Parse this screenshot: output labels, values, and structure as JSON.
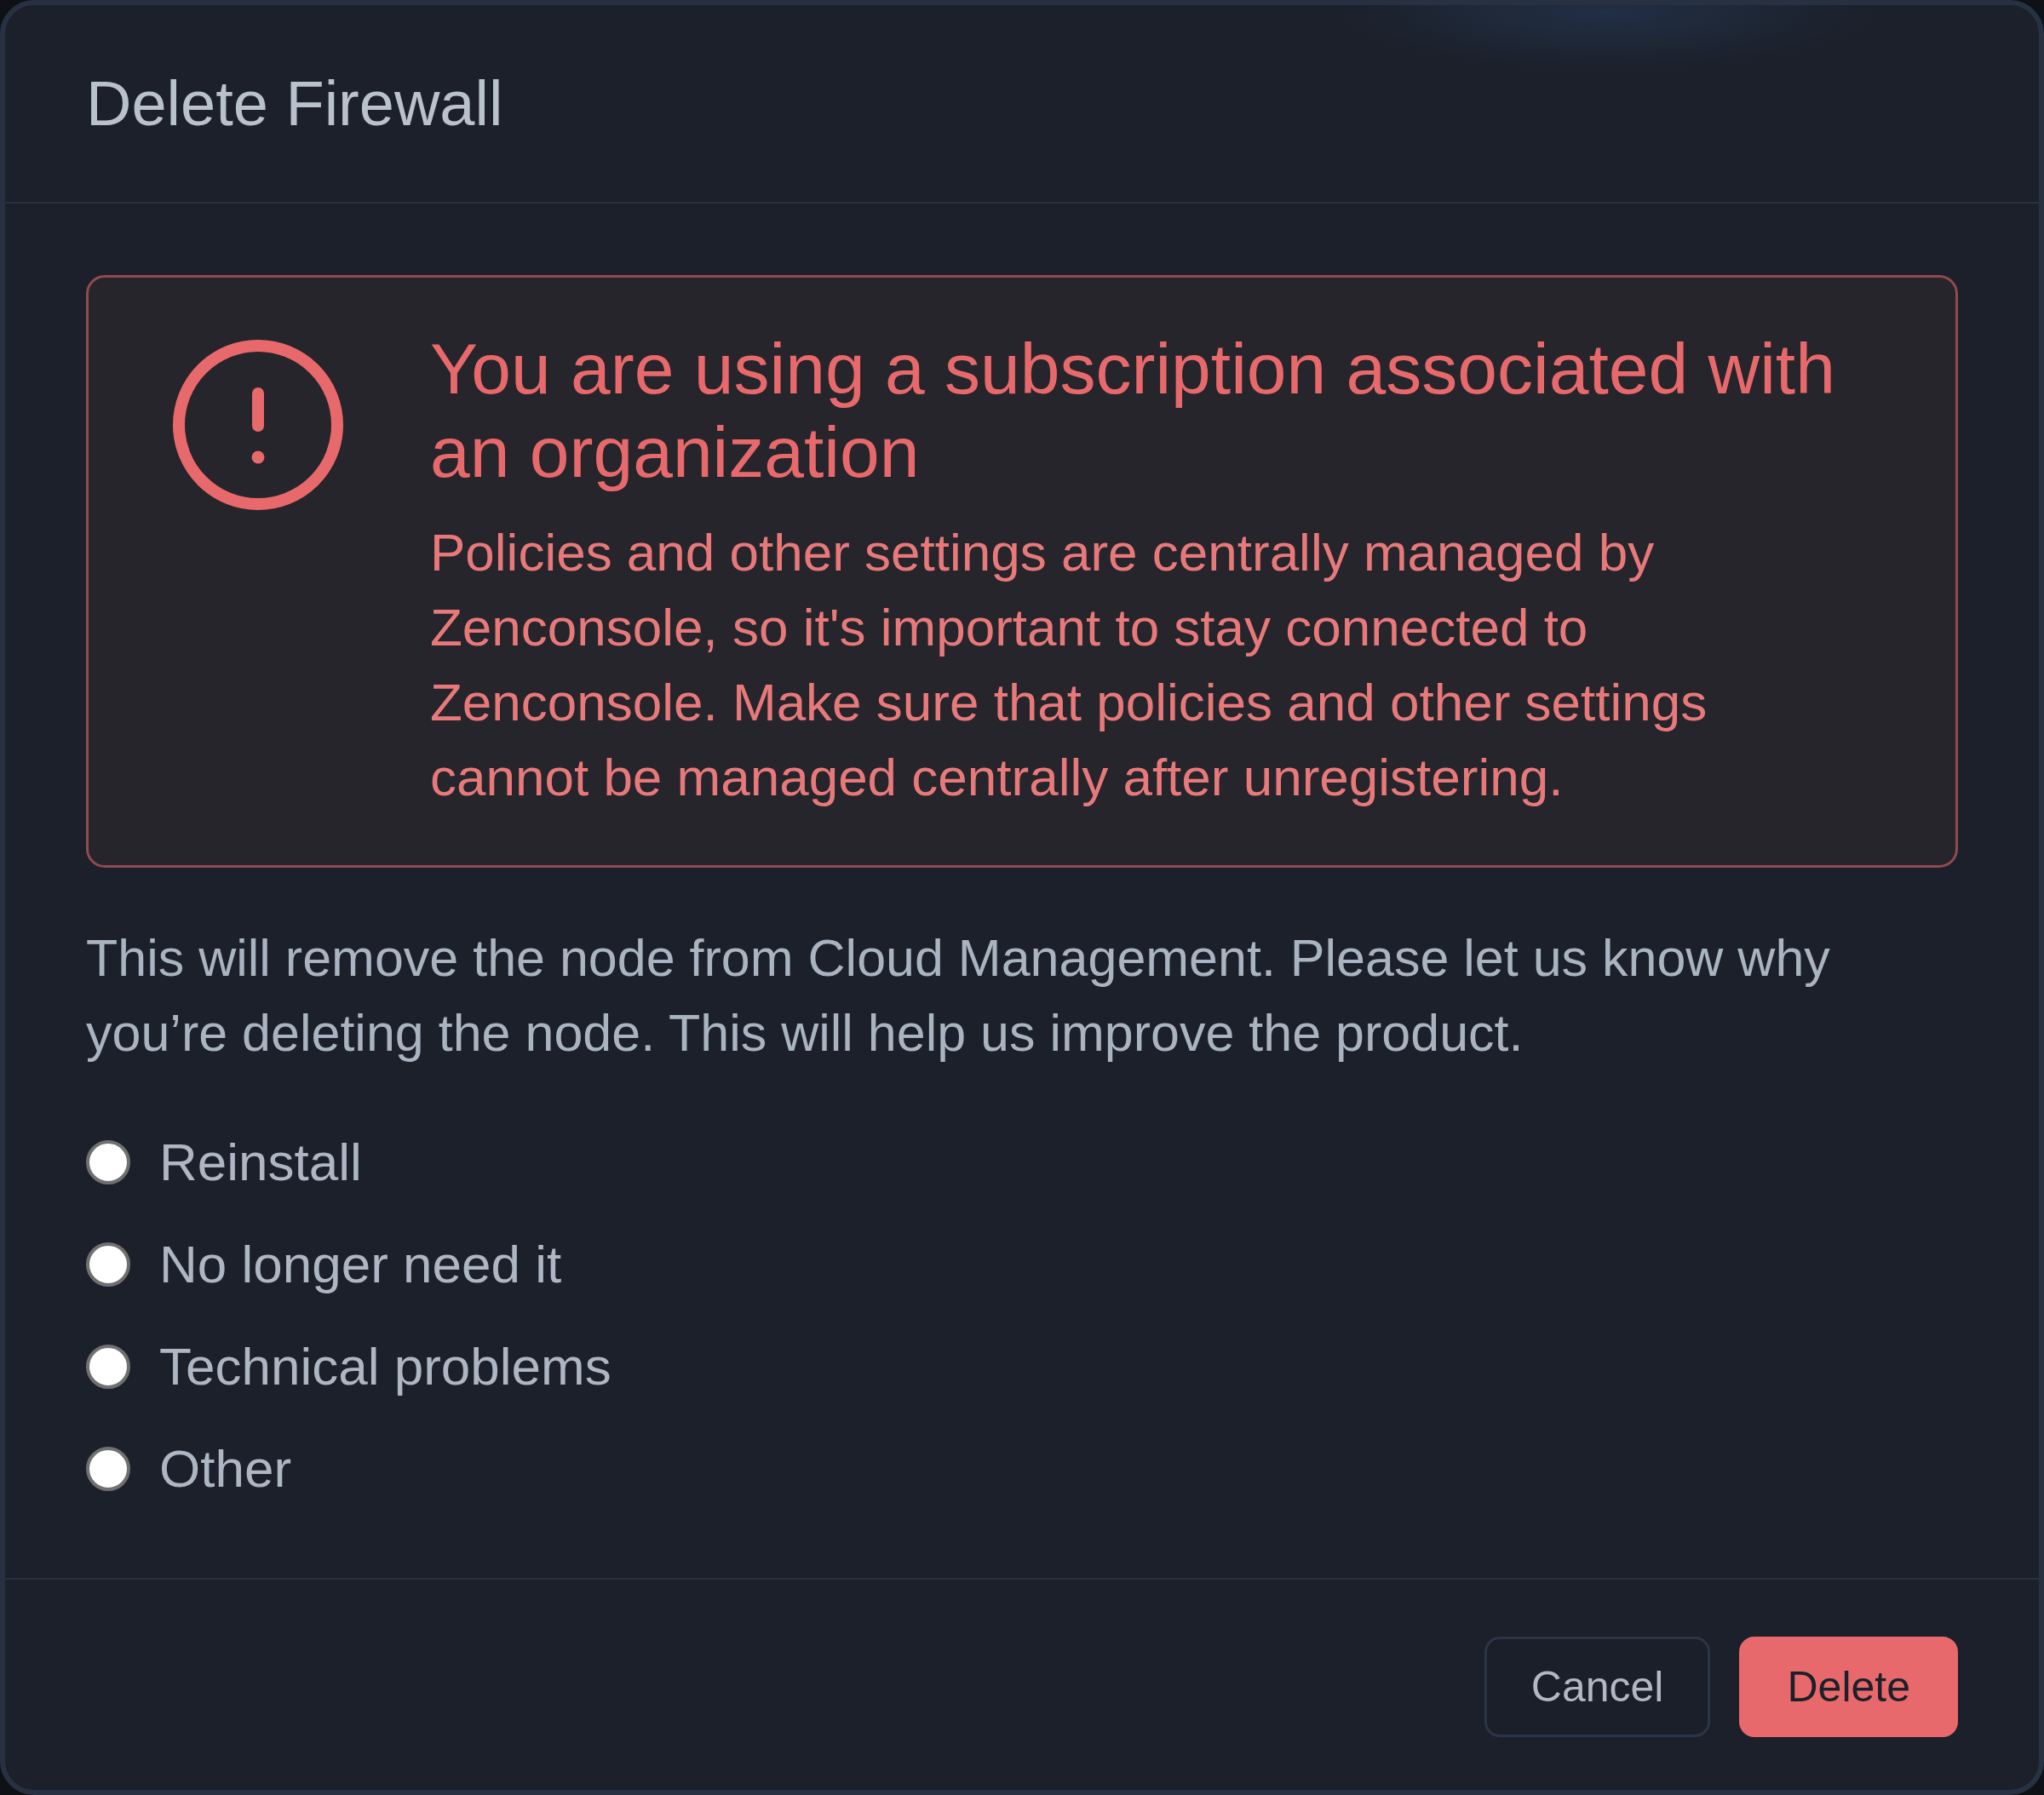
{
  "dialog": {
    "title": "Delete Firewall"
  },
  "alert": {
    "kind": "error",
    "title": "You are using a subscription associated with an organization",
    "message": "Policies and other settings are centrally managed by Zenconsole, so it's important to stay connected to Zenconsole. Make sure that policies and other settings cannot be managed centrally after unregistering."
  },
  "description": "This will remove the node from Cloud Management. Please let us know why you’re deleting the node. This will help us improve the product.",
  "reasons": [
    {
      "label": "Reinstall",
      "selected": false
    },
    {
      "label": "No longer need it",
      "selected": false
    },
    {
      "label": "Technical problems",
      "selected": false
    },
    {
      "label": "Other",
      "selected": false
    }
  ],
  "buttons": [
    {
      "label": "Cancel",
      "kind": "secondary"
    },
    {
      "label": "Delete",
      "kind": "danger"
    }
  ]
}
